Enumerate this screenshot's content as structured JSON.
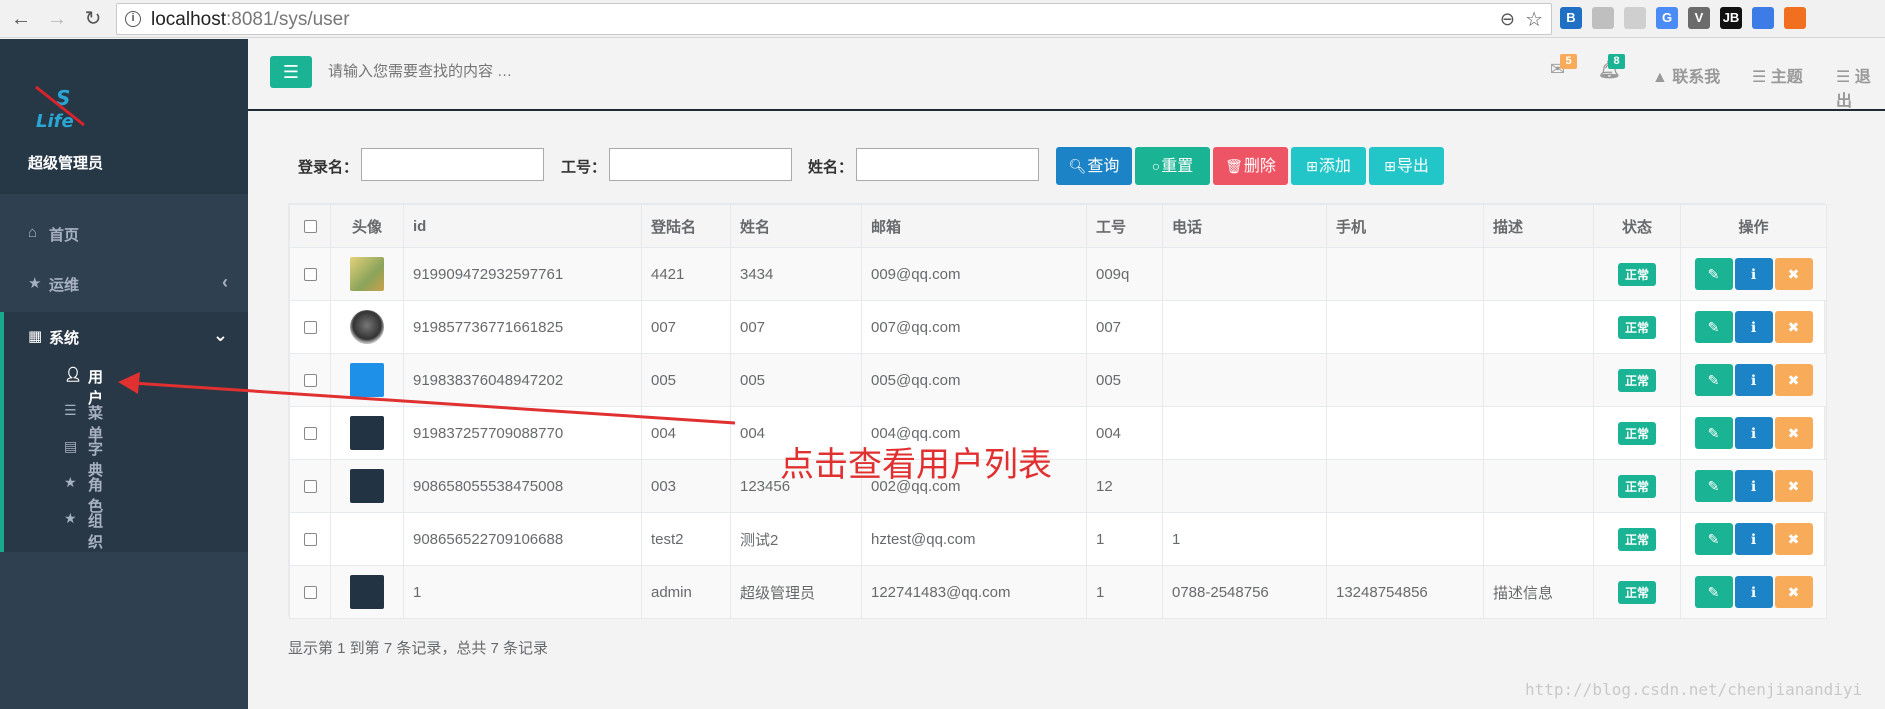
{
  "browser": {
    "url_host": "localhost",
    "url_port_path": ":8081/sys/user",
    "extensions": [
      {
        "label": "B",
        "color": "#1f6fc5"
      },
      {
        "label": "",
        "color": "#bfbfbf"
      },
      {
        "label": "",
        "color": "#cfcfcf"
      },
      {
        "label": "G",
        "color": "#4b8bf5"
      },
      {
        "label": "V",
        "color": "#6b6b6b"
      },
      {
        "label": "JB",
        "color": "#111111"
      },
      {
        "label": "",
        "color": "#3d7be6"
      },
      {
        "label": "",
        "color": "#f07020"
      }
    ]
  },
  "sidebar": {
    "admin_name": "超级管理员",
    "logo_text": "S Life",
    "menu": [
      {
        "icon": "home-icon",
        "label": "首页"
      },
      {
        "icon": "star-icon",
        "label": "运维",
        "caret": "‹"
      },
      {
        "icon": "grid-icon",
        "label": "系统",
        "caret": "⌄"
      }
    ],
    "submenu": [
      {
        "icon": "user-icon",
        "label": "用户",
        "active": true
      },
      {
        "icon": "list-icon",
        "label": "菜单"
      },
      {
        "icon": "book-icon",
        "label": "字典"
      },
      {
        "icon": "star-icon",
        "label": "角色"
      },
      {
        "icon": "star-icon",
        "label": "组织"
      }
    ]
  },
  "topbar": {
    "search_placeholder": "请输入您需要查找的内容 …",
    "mail_badge": "5",
    "bell_badge": "8",
    "contact_label": "联系我",
    "theme_label": "主题",
    "logout_label": "退出",
    "mail_badge_color": "#f8ac59",
    "bell_badge_color": "#1ab394"
  },
  "filters": {
    "login_label": "登录名：",
    "job_label": "工号：",
    "name_label": "姓名：",
    "login_value": "",
    "job_value": "",
    "name_value": ""
  },
  "buttons": {
    "query": "查询",
    "reset": "重置",
    "delete": "删除",
    "add": "添加",
    "export": "导出",
    "query_color": "#1c84c6",
    "reset_color": "#1ab394",
    "delete_color": "#ed5565",
    "add_color": "#23c6c8",
    "export_color": "#23c6c8"
  },
  "table": {
    "columns": [
      "",
      "头像",
      "id",
      "登陆名",
      "姓名",
      "邮箱",
      "工号",
      "电话",
      "手机",
      "描述",
      "状态",
      "操作"
    ],
    "rows": [
      {
        "avatar": "photo-a",
        "id": "919909472932597761",
        "login": "4421",
        "name": "3434",
        "email": "009@qq.com",
        "job": "009q",
        "phone": "",
        "mobile": "",
        "desc": "",
        "status": "正常"
      },
      {
        "avatar": "photo-b",
        "id": "919857736771661825",
        "login": "007",
        "name": "007",
        "email": "007@qq.com",
        "job": "007",
        "phone": "",
        "mobile": "",
        "desc": "",
        "status": "正常"
      },
      {
        "avatar": "logo-blue",
        "id": "919838376048947202",
        "login": "005",
        "name": "005",
        "email": "005@qq.com",
        "job": "005",
        "phone": "",
        "mobile": "",
        "desc": "",
        "status": "正常"
      },
      {
        "avatar": "logo-dark",
        "id": "919837257709088770",
        "login": "004",
        "name": "004",
        "email": "004@qq.com",
        "job": "004",
        "phone": "",
        "mobile": "",
        "desc": "",
        "status": "正常"
      },
      {
        "avatar": "logo-dark",
        "id": "908658055538475008",
        "login": "003",
        "name": "123456",
        "email": "002@qq.com",
        "job": "12",
        "phone": "",
        "mobile": "",
        "desc": "",
        "status": "正常"
      },
      {
        "avatar": "",
        "id": "908656522709106688",
        "login": "test2",
        "name": "测试2",
        "email": "hztest@qq.com",
        "job": "1",
        "phone": "1",
        "mobile": "",
        "desc": "",
        "status": "正常"
      },
      {
        "avatar": "logo-dark",
        "id": "1",
        "login": "admin",
        "name": "超级管理员",
        "email": "122741483@qq.com",
        "job": "1",
        "phone": "0788-2548756",
        "mobile": "13248754856",
        "desc": "描述信息",
        "status": "正常"
      }
    ],
    "action_colors": [
      "#1ab394",
      "#1c84c6",
      "#f8ac59"
    ]
  },
  "pager_text": "显示第 1 到第 7 条记录，总共 7 条记录",
  "annotation": "点击查看用户列表",
  "watermark": "http://blog.csdn.net/chenjianandiyi"
}
